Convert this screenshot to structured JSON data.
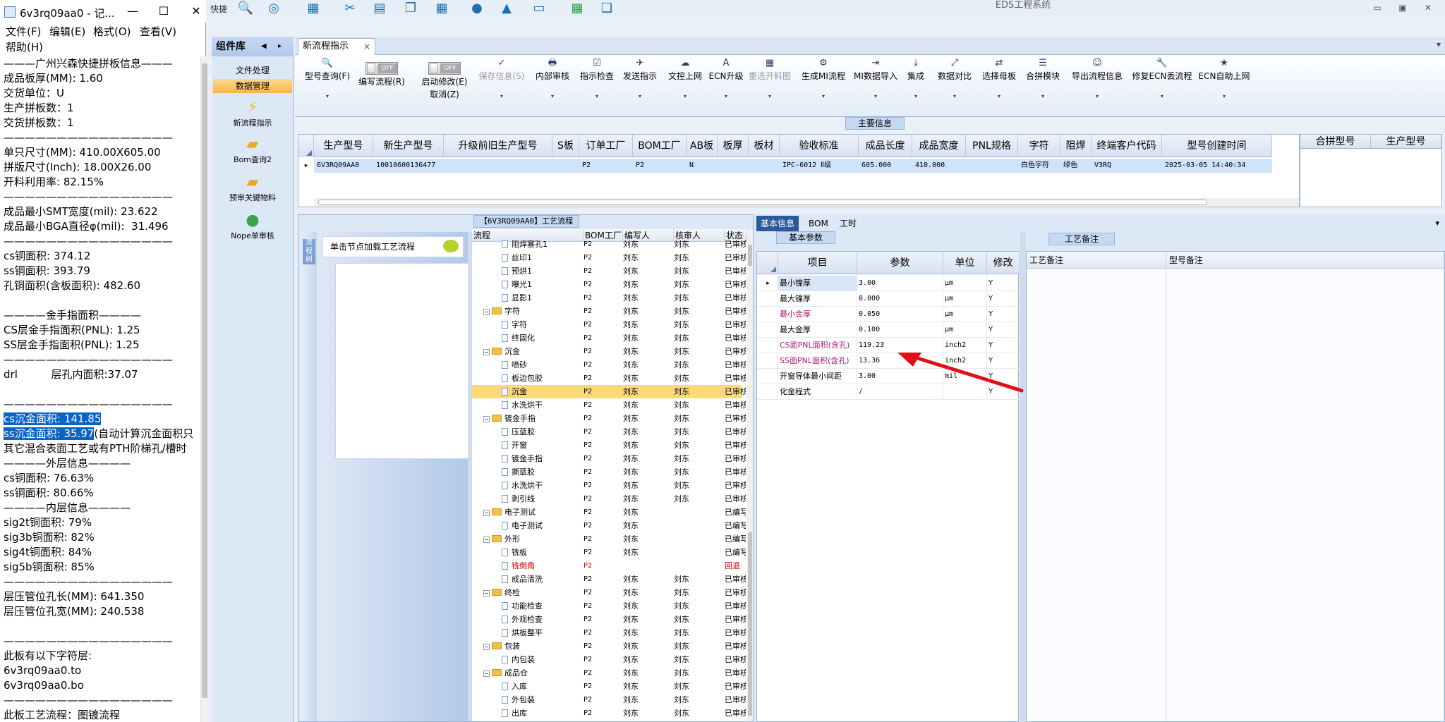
{
  "eds": {
    "title": "EDS工程系统",
    "quicktool_label": "快捷",
    "window_controls": [
      "▭",
      "▣",
      "✕"
    ]
  },
  "notepad": {
    "title": "6v3rq09aa0 - 记...",
    "controls": [
      "—",
      "☐",
      "✕"
    ],
    "menu": [
      "文件(F)",
      "编辑(E)",
      "格式(O)",
      "查看(V)",
      "帮助(H)"
    ],
    "lines": [
      "———广州兴森快捷拼板信息———",
      "成品板厚(MM): 1.60",
      "交货单位：U",
      "生产拼板数：1",
      "交货拼板数：1",
      "————————————————",
      "单只尺寸(MM): 410.00X605.00",
      "拼版尺寸(Inch): 18.00X26.00",
      "开料利用率: 82.15%",
      "————————————————",
      "成品最小SMT宽度(mil): 23.622",
      "成品最小BGA直径φ(mil):  31.496",
      "————————————————",
      "cs铜面积: 374.12",
      "ss铜面积: 393.79",
      "孔铜面积(含板面积): 482.60",
      "",
      "————金手指面积————",
      "CS层金手指面积(PNL): 1.25",
      "SS层金手指面积(PNL): 1.25",
      "————————————————",
      "drl          层孔内面积:37.07",
      "",
      "————————————————",
      "cs沉金面积: 141.85",
      "ss沉金面积: 35.97(自动计算沉金面积只",
      "其它混合表面工艺或有PTH阶梯孔/槽时",
      "————外层信息————",
      "cs铜面积: 76.63%",
      "ss铜面积: 80.66%",
      "————内层信息————",
      "sig2t铜面积: 79%",
      "sig3b铜面积: 82%",
      "sig4t铜面积: 84%",
      "sig5b铜面积: 85%",
      "————————————————",
      "层压管位孔长(MM): 641.350",
      "层压管位孔宽(MM): 240.538",
      "",
      "————————————————",
      "此板有以下字符层:",
      "6v3rq09aa0.to",
      "6v3rq09aa0.bo",
      "————————————————",
      "此板工艺流程：图镀流程"
    ],
    "highlight_1": "cs沉金面积: 141.85",
    "highlight_2": "ss沉金面积: 35.97"
  },
  "components": {
    "header": "组件库",
    "tabs": [
      "文件处理",
      "数据管理"
    ],
    "items": [
      "新流程指示",
      "Bom查询2",
      "预审关键物料",
      "Nope单审核"
    ]
  },
  "main_tab": {
    "label": "新流程指示",
    "close": "×"
  },
  "ribbon": {
    "buttons": [
      {
        "label": "型号查询(F)",
        "icon": "🔍"
      },
      {
        "label": "编写流程(R)",
        "toggle": "OFF"
      },
      {
        "label": "启动修改(E)\n取消(Z)",
        "toggle": "OFF"
      },
      {
        "label": "保存信息(S)",
        "icon": "✓",
        "disabled": true
      },
      {
        "label": "内部审核",
        "icon": "🖶"
      },
      {
        "label": "指示检查",
        "icon": "☑"
      },
      {
        "label": "发送指示",
        "icon": "✈"
      },
      {
        "label": "文控上网",
        "icon": "☁"
      },
      {
        "label": "ECN升级",
        "icon": "A"
      },
      {
        "label": "重选开料图",
        "icon": "▦",
        "disabled": true
      },
      {
        "label": "生成MI流程",
        "icon": "⚙"
      },
      {
        "label": "MI数据导入",
        "icon": "⇥"
      },
      {
        "label": "集成",
        "icon": "⤓"
      },
      {
        "label": "数据对比",
        "icon": "⤢"
      },
      {
        "label": "选择母板",
        "icon": "⇄"
      },
      {
        "label": "合拼模块",
        "icon": "☰"
      },
      {
        "label": "导出流程信息",
        "icon": "☺"
      },
      {
        "label": "修复ECN丢流程",
        "icon": "🔧"
      },
      {
        "label": "ECN自助上网",
        "icon": "★"
      }
    ]
  },
  "main_info": {
    "caption": "主要信息",
    "headers": [
      "生产型号",
      "新生产型号",
      "升级前旧生产型号",
      "S板",
      "订单工厂",
      "BOM工厂",
      "AB板",
      "板厚",
      "板材",
      "验收标准",
      "成品长度",
      "成品宽度",
      "PNL规格",
      "字符",
      "阻焊",
      "终端客户代码",
      "型号创建时间"
    ],
    "row": [
      "6V3RQ09AA0",
      "10010600136477",
      "",
      "",
      "P2",
      "P2",
      "N",
      "",
      "",
      "IPC-6012 Ⅱ级",
      "605.000",
      "410.000",
      "",
      "白色字符",
      "绿色",
      "V3RQ",
      "2025-03-05 14:40:34"
    ],
    "side_headers": [
      "合拼型号",
      "生产型号"
    ]
  },
  "flow": {
    "caption": "【6V3RQ09AA0】工艺流程",
    "strip_label": "流程树",
    "hint": "单击节点加载工艺流程",
    "headers": [
      "流程",
      "BOM工厂",
      "编写人",
      "核审人",
      "状态"
    ],
    "rows": [
      {
        "name": "阻焊塞孔1",
        "level": 2,
        "fac": "P2",
        "w": "刘东",
        "r": "刘东",
        "st": "已审核"
      },
      {
        "name": "丝印1",
        "level": 2,
        "fac": "P2",
        "w": "刘东",
        "r": "刘东",
        "st": "已审核"
      },
      {
        "name": "预烘1",
        "level": 2,
        "fac": "P2",
        "w": "刘东",
        "r": "刘东",
        "st": "已审核"
      },
      {
        "name": "曝光1",
        "level": 2,
        "fac": "P2",
        "w": "刘东",
        "r": "刘东",
        "st": "已审核"
      },
      {
        "name": "显影1",
        "level": 2,
        "fac": "P2",
        "w": "刘东",
        "r": "刘东",
        "st": "已审核"
      },
      {
        "name": "字符",
        "level": 1,
        "fac": "P2",
        "w": "刘东",
        "r": "刘东",
        "st": "已审核"
      },
      {
        "name": "字符",
        "level": 2,
        "fac": "P2",
        "w": "刘东",
        "r": "刘东",
        "st": "已审核"
      },
      {
        "name": "终固化",
        "level": 2,
        "fac": "P2",
        "w": "刘东",
        "r": "刘东",
        "st": "已审核"
      },
      {
        "name": "沉金",
        "level": 1,
        "fac": "P2",
        "w": "刘东",
        "r": "刘东",
        "st": "已审核"
      },
      {
        "name": "喷砂",
        "level": 2,
        "fac": "P2",
        "w": "刘东",
        "r": "刘东",
        "st": "已审核"
      },
      {
        "name": "板边包胶",
        "level": 2,
        "fac": "P2",
        "w": "刘东",
        "r": "刘东",
        "st": "已审核"
      },
      {
        "name": "沉金",
        "level": 2,
        "fac": "P2",
        "w": "刘东",
        "r": "刘东",
        "st": "已审核",
        "selected": true
      },
      {
        "name": "水洗烘干",
        "level": 2,
        "fac": "P2",
        "w": "刘东",
        "r": "刘东",
        "st": "已审核"
      },
      {
        "name": "镀金手指",
        "level": 1,
        "fac": "P2",
        "w": "刘东",
        "r": "刘东",
        "st": "已审核"
      },
      {
        "name": "压蓝胶",
        "level": 2,
        "fac": "P2",
        "w": "刘东",
        "r": "刘东",
        "st": "已审核"
      },
      {
        "name": "开窗",
        "level": 2,
        "fac": "P2",
        "w": "刘东",
        "r": "刘东",
        "st": "已审核"
      },
      {
        "name": "镀金手指",
        "level": 2,
        "fac": "P2",
        "w": "刘东",
        "r": "刘东",
        "st": "已审核"
      },
      {
        "name": "撕蓝胶",
        "level": 2,
        "fac": "P2",
        "w": "刘东",
        "r": "刘东",
        "st": "已审核"
      },
      {
        "name": "水洗烘干",
        "level": 2,
        "fac": "P2",
        "w": "刘东",
        "r": "刘东",
        "st": "已审核"
      },
      {
        "name": "剥引线",
        "level": 2,
        "fac": "P2",
        "w": "刘东",
        "r": "刘东",
        "st": "已审核"
      },
      {
        "name": "电子测试",
        "level": 1,
        "fac": "P2",
        "w": "刘东",
        "r": "",
        "st": "已编写"
      },
      {
        "name": "电子测试",
        "level": 2,
        "fac": "P2",
        "w": "刘东",
        "r": "",
        "st": "已编写"
      },
      {
        "name": "外形",
        "level": 1,
        "fac": "P2",
        "w": "刘东",
        "r": "",
        "st": "已编写"
      },
      {
        "name": "铣板",
        "level": 2,
        "fac": "P2",
        "w": "刘东",
        "r": "",
        "st": "已编写"
      },
      {
        "name": "铣倒角",
        "level": 2,
        "fac": "P2",
        "w": "",
        "r": "",
        "st": "回退",
        "red": true
      },
      {
        "name": "成品清洗",
        "level": 2,
        "fac": "P2",
        "w": "刘东",
        "r": "刘东",
        "st": "已审核"
      },
      {
        "name": "终检",
        "level": 1,
        "fac": "P2",
        "w": "刘东",
        "r": "刘东",
        "st": "已审核"
      },
      {
        "name": "功能检查",
        "level": 2,
        "fac": "P2",
        "w": "刘东",
        "r": "刘东",
        "st": "已审核"
      },
      {
        "name": "外观检查",
        "level": 2,
        "fac": "P2",
        "w": "刘东",
        "r": "刘东",
        "st": "已审核"
      },
      {
        "name": "烘板整平",
        "level": 2,
        "fac": "P2",
        "w": "刘东",
        "r": "刘东",
        "st": "已审核"
      },
      {
        "name": "包装",
        "level": 1,
        "fac": "P2",
        "w": "刘东",
        "r": "刘东",
        "st": "已审核"
      },
      {
        "name": "内包装",
        "level": 2,
        "fac": "P2",
        "w": "刘东",
        "r": "刘东",
        "st": "已审核"
      },
      {
        "name": "成品仓",
        "level": 1,
        "fac": "P2",
        "w": "刘东",
        "r": "刘东",
        "st": "已审核"
      },
      {
        "name": "入库",
        "level": 2,
        "fac": "P2",
        "w": "刘东",
        "r": "刘东",
        "st": "已审核"
      },
      {
        "name": "外包装",
        "level": 2,
        "fac": "P2",
        "w": "刘东",
        "r": "刘东",
        "st": "已审核"
      },
      {
        "name": "出库",
        "level": 2,
        "fac": "P2",
        "w": "刘东",
        "r": "刘东",
        "st": "已审核"
      }
    ]
  },
  "info": {
    "tabs": [
      "基本信息",
      "BOM",
      "工时"
    ],
    "basic_caption": "基本参数",
    "headers": [
      "项目",
      "参数",
      "单位",
      "修改"
    ],
    "rows": [
      {
        "item": "最小镍厚",
        "param": "3.00",
        "unit": "μm",
        "mod": "Y",
        "pointer": "▸",
        "hl": true
      },
      {
        "item": "最大镍厚",
        "param": "8.000",
        "unit": "μm",
        "mod": "Y"
      },
      {
        "item": "最小金厚",
        "param": "0.050",
        "unit": "μm",
        "mod": "Y",
        "pink": true
      },
      {
        "item": "最大金厚",
        "param": "0.100",
        "unit": "μm",
        "mod": "Y"
      },
      {
        "item": "CS面PNL面积(含孔)",
        "param": "119.23",
        "unit": "inch2",
        "mod": "Y",
        "pink": true
      },
      {
        "item": "SS面PNL面积(含孔)",
        "param": "13.36",
        "unit": "inch2",
        "mod": "Y",
        "pink": true
      },
      {
        "item": "开窗导体最小间距",
        "param": "3.00",
        "unit": "mil",
        "mod": "Y"
      },
      {
        "item": "化金程式",
        "param": "/",
        "unit": "",
        "mod": "Y"
      }
    ],
    "remark_caption": "工艺备注",
    "remark_headers": [
      "工艺备注",
      "型号备注"
    ],
    "arrow_color": "#e0101a"
  }
}
